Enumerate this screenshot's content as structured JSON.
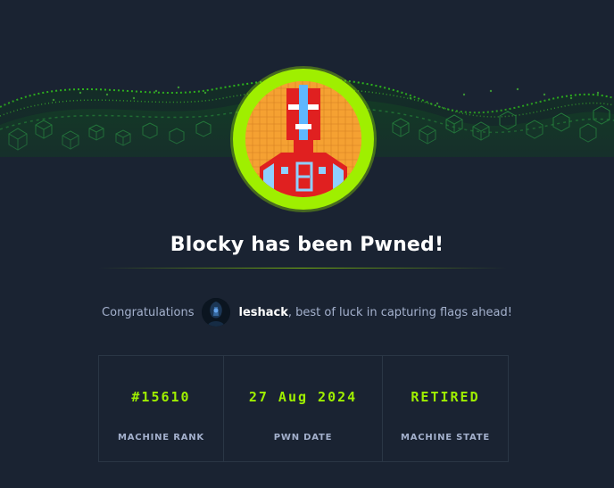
{
  "title": "Blocky has been Pwned!",
  "congrats": {
    "prefix": "Congratulations",
    "username": "leshack",
    "suffix": ", best of luck in capturing flags ahead!"
  },
  "stats": [
    {
      "value": "#15610",
      "label": "MACHINE RANK"
    },
    {
      "value": "27 Aug 2024",
      "label": "PWN DATE"
    },
    {
      "value": "RETIRED",
      "label": "MACHINE STATE"
    }
  ],
  "colors": {
    "background": "#1a2332",
    "accent": "#9fef00",
    "muted_text": "#a4b1cd",
    "border": "#2a3645"
  },
  "icons": {
    "banner": "green-cube-wave-banner",
    "machine_avatar": "blocky-machine-avatar",
    "user_avatar": "user-avatar-image"
  }
}
